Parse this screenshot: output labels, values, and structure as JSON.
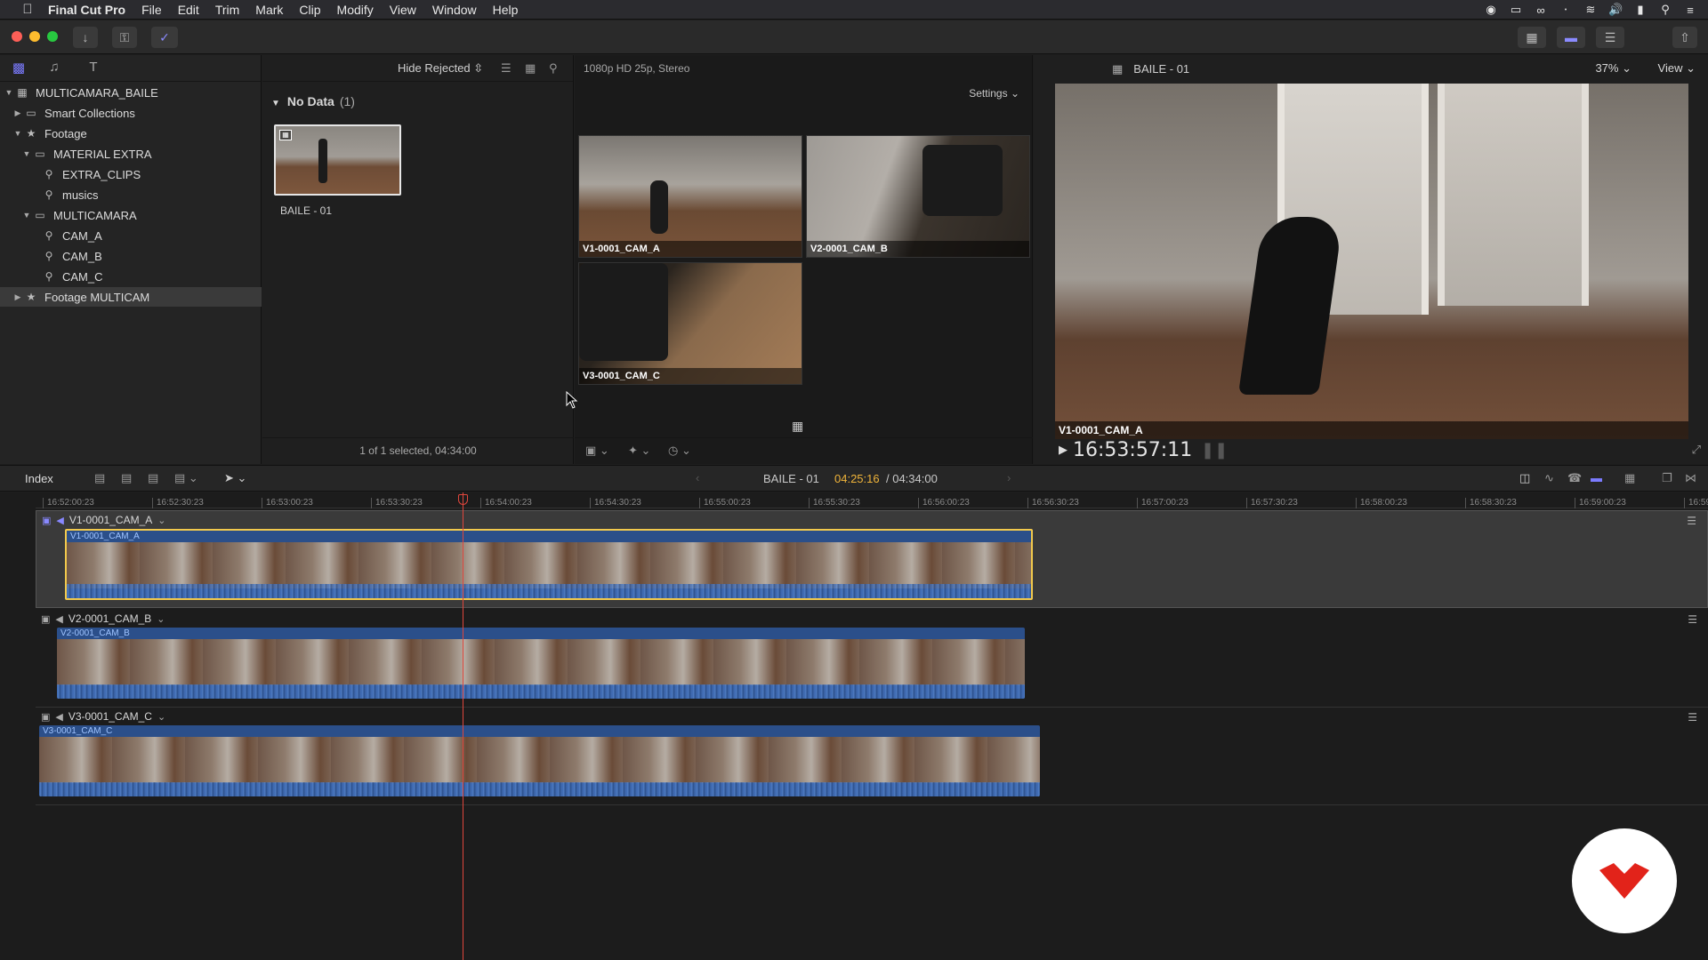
{
  "menubar": {
    "app_name": "Final Cut Pro",
    "items": [
      "File",
      "Edit",
      "Trim",
      "Mark",
      "Clip",
      "Modify",
      "View",
      "Window",
      "Help"
    ]
  },
  "sidebar": {
    "items": [
      {
        "label": "MULTICAMARA_BAILE",
        "icon": "library-icon",
        "expanded": true,
        "level": 0
      },
      {
        "label": "Smart Collections",
        "icon": "folder-icon",
        "expanded": false,
        "level": 1
      },
      {
        "label": "Footage",
        "icon": "event-icon",
        "expanded": true,
        "level": 1
      },
      {
        "label": "MATERIAL EXTRA",
        "icon": "folder-icon",
        "expanded": true,
        "level": 2
      },
      {
        "label": "EXTRA_CLIPS",
        "icon": "keyword-icon",
        "level": 3
      },
      {
        "label": "musics",
        "icon": "keyword-icon",
        "level": 3
      },
      {
        "label": "MULTICAMARA",
        "icon": "folder-icon",
        "expanded": true,
        "level": 2
      },
      {
        "label": "CAM_A",
        "icon": "keyword-icon",
        "level": 3
      },
      {
        "label": "CAM_B",
        "icon": "keyword-icon",
        "level": 3
      },
      {
        "label": "CAM_C",
        "icon": "keyword-icon",
        "level": 3
      },
      {
        "label": "Footage MULTICAM",
        "icon": "event-icon",
        "expanded": false,
        "level": 1,
        "selected": true
      }
    ]
  },
  "browser": {
    "filter_label": "Hide Rejected",
    "group_name": "No Data",
    "group_count": "(1)",
    "clip_title": "BAILE - 01",
    "selection_info": "1 of 1 selected, 04:34:00"
  },
  "angle_viewer": {
    "format_label": "1080p HD 25p, Stereo",
    "settings_label": "Settings",
    "angles": [
      "V1-0001_CAM_A",
      "V2-0001_CAM_B",
      "V3-0001_CAM_C"
    ]
  },
  "viewer": {
    "title": "BAILE - 01",
    "zoom": "37%",
    "view_label": "View",
    "active_angle": "V1-0001_CAM_A",
    "timecode": "16:53:57:11"
  },
  "timeline_bar": {
    "index_label": "Index",
    "project_name": "BAILE - 01",
    "position": "04:25:16",
    "duration": "/ 04:34:00"
  },
  "timeline": {
    "ruler_ticks": [
      "16:52:00:23",
      "16:52:30:23",
      "16:53:00:23",
      "16:53:30:23",
      "16:54:00:23",
      "16:54:30:23",
      "16:55:00:23",
      "16:55:30:23",
      "16:56:00:23",
      "16:56:30:23",
      "16:57:00:23",
      "16:57:30:23",
      "16:58:00:23",
      "16:58:30:23",
      "16:59:00:23",
      "16:59"
    ],
    "lanes": [
      {
        "name": "V1-0001_CAM_A",
        "clip": "V1-0001_CAM_A"
      },
      {
        "name": "V2-0001_CAM_B",
        "clip": "V2-0001_CAM_B"
      },
      {
        "name": "V3-0001_CAM_C",
        "clip": "V3-0001_CAM_C"
      }
    ]
  },
  "colors": {
    "accent": "#7b7bff",
    "timecode_position": "#f0b43a",
    "playhead": "#e0463c",
    "clip_blue": "#2b4f8a",
    "selection_yellow": "#f2c94c",
    "logo_red": "#e2231a"
  }
}
